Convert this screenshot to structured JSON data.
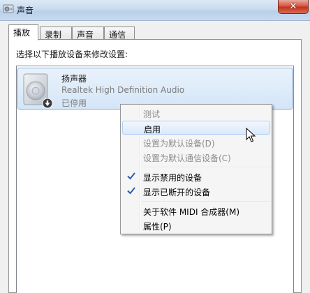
{
  "window": {
    "title": "声音",
    "close_glyph": "✕",
    "icon": "speaker-app-icon"
  },
  "tabs": [
    {
      "label": "播放",
      "active": true
    },
    {
      "label": "录制",
      "active": false
    },
    {
      "label": "声音",
      "active": false
    },
    {
      "label": "通信",
      "active": false
    }
  ],
  "playback": {
    "instruction": "选择以下播放设备来修改设置:",
    "devices": [
      {
        "name": "扬声器",
        "driver": "Realtek High Definition Audio",
        "status": "已停用",
        "icon": "speaker-device-icon",
        "overlay_icon": "disabled-arrow-icon"
      }
    ]
  },
  "context_menu": {
    "items": [
      {
        "label": "测试",
        "enabled": false,
        "checked": false
      },
      {
        "label": "启用",
        "enabled": true,
        "checked": false,
        "highlighted": true
      },
      {
        "label": "设置为默认设备(D)",
        "enabled": false,
        "checked": false
      },
      {
        "label": "设置为默认通信设备(C)",
        "enabled": false,
        "checked": false
      },
      {
        "label": "显示禁用的设备",
        "enabled": true,
        "checked": true
      },
      {
        "label": "显示已断开的设备",
        "enabled": true,
        "checked": true
      },
      {
        "label": "关于软件 MIDI 合成器(M)",
        "enabled": true,
        "checked": false
      },
      {
        "label": "属性(P)",
        "enabled": true,
        "checked": false
      }
    ]
  },
  "colors": {
    "selection_border": "#84acdd",
    "menu_highlight": "#dbe9fa",
    "check_color": "#2a5fb0",
    "close_button": "#c2331d"
  }
}
